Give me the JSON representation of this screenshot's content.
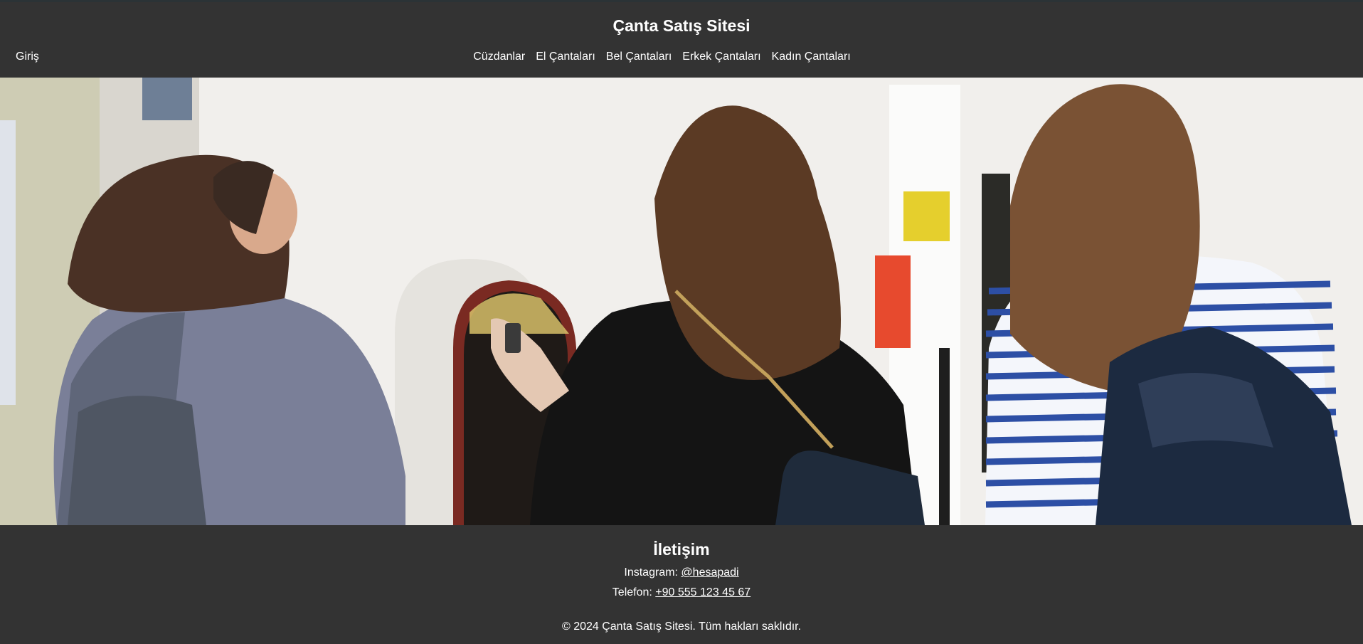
{
  "header": {
    "title": "Çanta Satış Sitesi",
    "login_label": "Giriş",
    "nav_items": [
      "Cüzdanlar",
      "El Çantaları",
      "Bel Çantaları",
      "Erkek Çantaları",
      "Kadın Çantaları"
    ]
  },
  "hero": {
    "alt": "three women walking with bags"
  },
  "footer": {
    "contact_title": "İletişim",
    "instagram_label": "Instagram:",
    "instagram_handle": "@hesapadi",
    "phone_label": "Telefon:",
    "phone_number": "+90 555 123 45 67",
    "copyright": "© 2024 Çanta Satış Sitesi. Tüm hakları saklıdır."
  },
  "colors": {
    "header_bg": "#333333",
    "footer_bg": "#333333",
    "text": "#ffffff"
  }
}
